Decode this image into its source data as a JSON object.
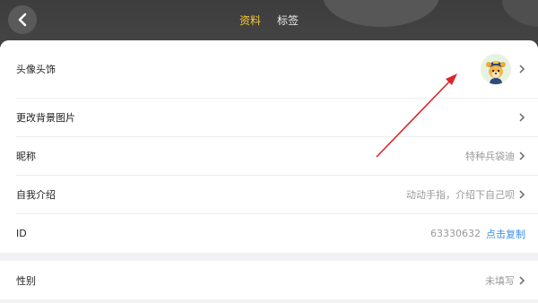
{
  "header": {
    "tabs": [
      {
        "label": "资料",
        "active": true
      },
      {
        "label": "标签",
        "active": false
      }
    ]
  },
  "profile": {
    "avatar_label": "头像头饰",
    "background_label": "更改背景图片",
    "nickname_label": "昵称",
    "nickname_value": "特种兵袋迪",
    "intro_label": "自我介绍",
    "intro_value": "动动手指，介绍下自己呗",
    "id_label": "ID",
    "id_value": "63330632",
    "copy_label": "点击复制",
    "gender_label": "性别",
    "gender_value": "未填写"
  },
  "colors": {
    "active_tab": "#f3c83b",
    "link": "#3b8fe8",
    "annotation_arrow": "#d9262c"
  }
}
